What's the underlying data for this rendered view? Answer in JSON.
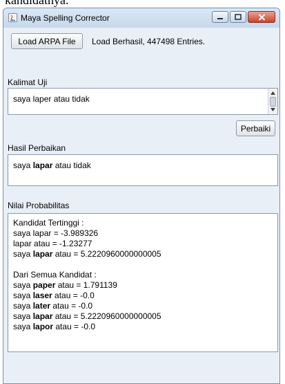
{
  "page_fragment": "kandidatnya.",
  "window": {
    "title": "Maya Spelling Corrector"
  },
  "toolbar": {
    "load_button_label": "Load ARPA File",
    "load_status": "Load Berhasil, 447498 Entries."
  },
  "input_section": {
    "label": "Kalimat Uji",
    "value": "saya laper atau tidak",
    "fix_button_label": "Perbaiki"
  },
  "result_section": {
    "label": "Hasil Perbaikan",
    "prefix": "saya ",
    "corrected_word": "lapar",
    "suffix": " atau tidak"
  },
  "probability_section": {
    "label": "Nilai Probabilitas",
    "top_header": "Kandidat Tertinggi :",
    "top_lines": [
      {
        "pre": "saya lapar = -3.989326",
        "bold": "",
        "post": ""
      },
      {
        "pre": "lapar atau = -1.23277",
        "bold": "",
        "post": ""
      },
      {
        "pre": "saya ",
        "bold": "lapar",
        "post": " atau = 5.2220960000000005"
      }
    ],
    "all_header": "Dari Semua Kandidat :",
    "all_lines": [
      {
        "pre": "saya ",
        "bold": "paper",
        "post": " atau = 1.791139"
      },
      {
        "pre": "saya ",
        "bold": "laser",
        "post": " atau = -0.0"
      },
      {
        "pre": "saya ",
        "bold": "later",
        "post": " atau = -0.0"
      },
      {
        "pre": "saya ",
        "bold": "lapar",
        "post": " atau = 5.2220960000000005"
      },
      {
        "pre": "saya ",
        "bold": "lapor",
        "post": " atau = -0.0"
      }
    ]
  },
  "colors": {
    "window_background": "#e9eff6",
    "close_button": "#c7452d"
  },
  "icons": [
    "java-app-icon",
    "minimize-icon",
    "maximize-icon",
    "close-icon",
    "scroll-up-icon",
    "scroll-down-icon"
  ]
}
